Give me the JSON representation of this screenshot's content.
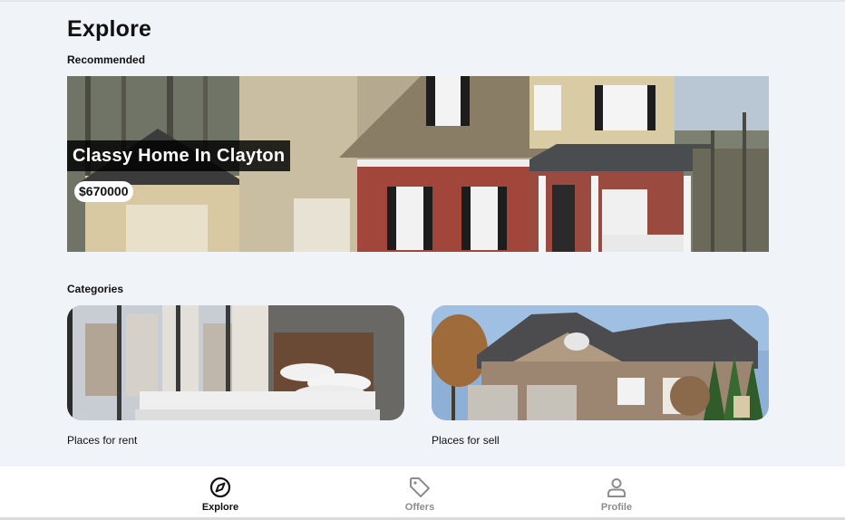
{
  "page": {
    "title": "Explore"
  },
  "recommended": {
    "heading": "Recommended",
    "featured": {
      "name": "Classy Home In Clayton",
      "price": "$670000"
    }
  },
  "categories": {
    "heading": "Categories",
    "items": [
      {
        "label": "Places for rent"
      },
      {
        "label": "Places for sell"
      }
    ]
  },
  "nav": {
    "items": [
      {
        "label": "Explore",
        "icon": "compass-icon",
        "active": true
      },
      {
        "label": "Offers",
        "icon": "tag-icon",
        "active": false
      },
      {
        "label": "Profile",
        "icon": "user-icon",
        "active": false
      }
    ]
  },
  "colors": {
    "background": "#f0f3f8",
    "active": "#111111",
    "inactive": "#8d8d8d"
  }
}
